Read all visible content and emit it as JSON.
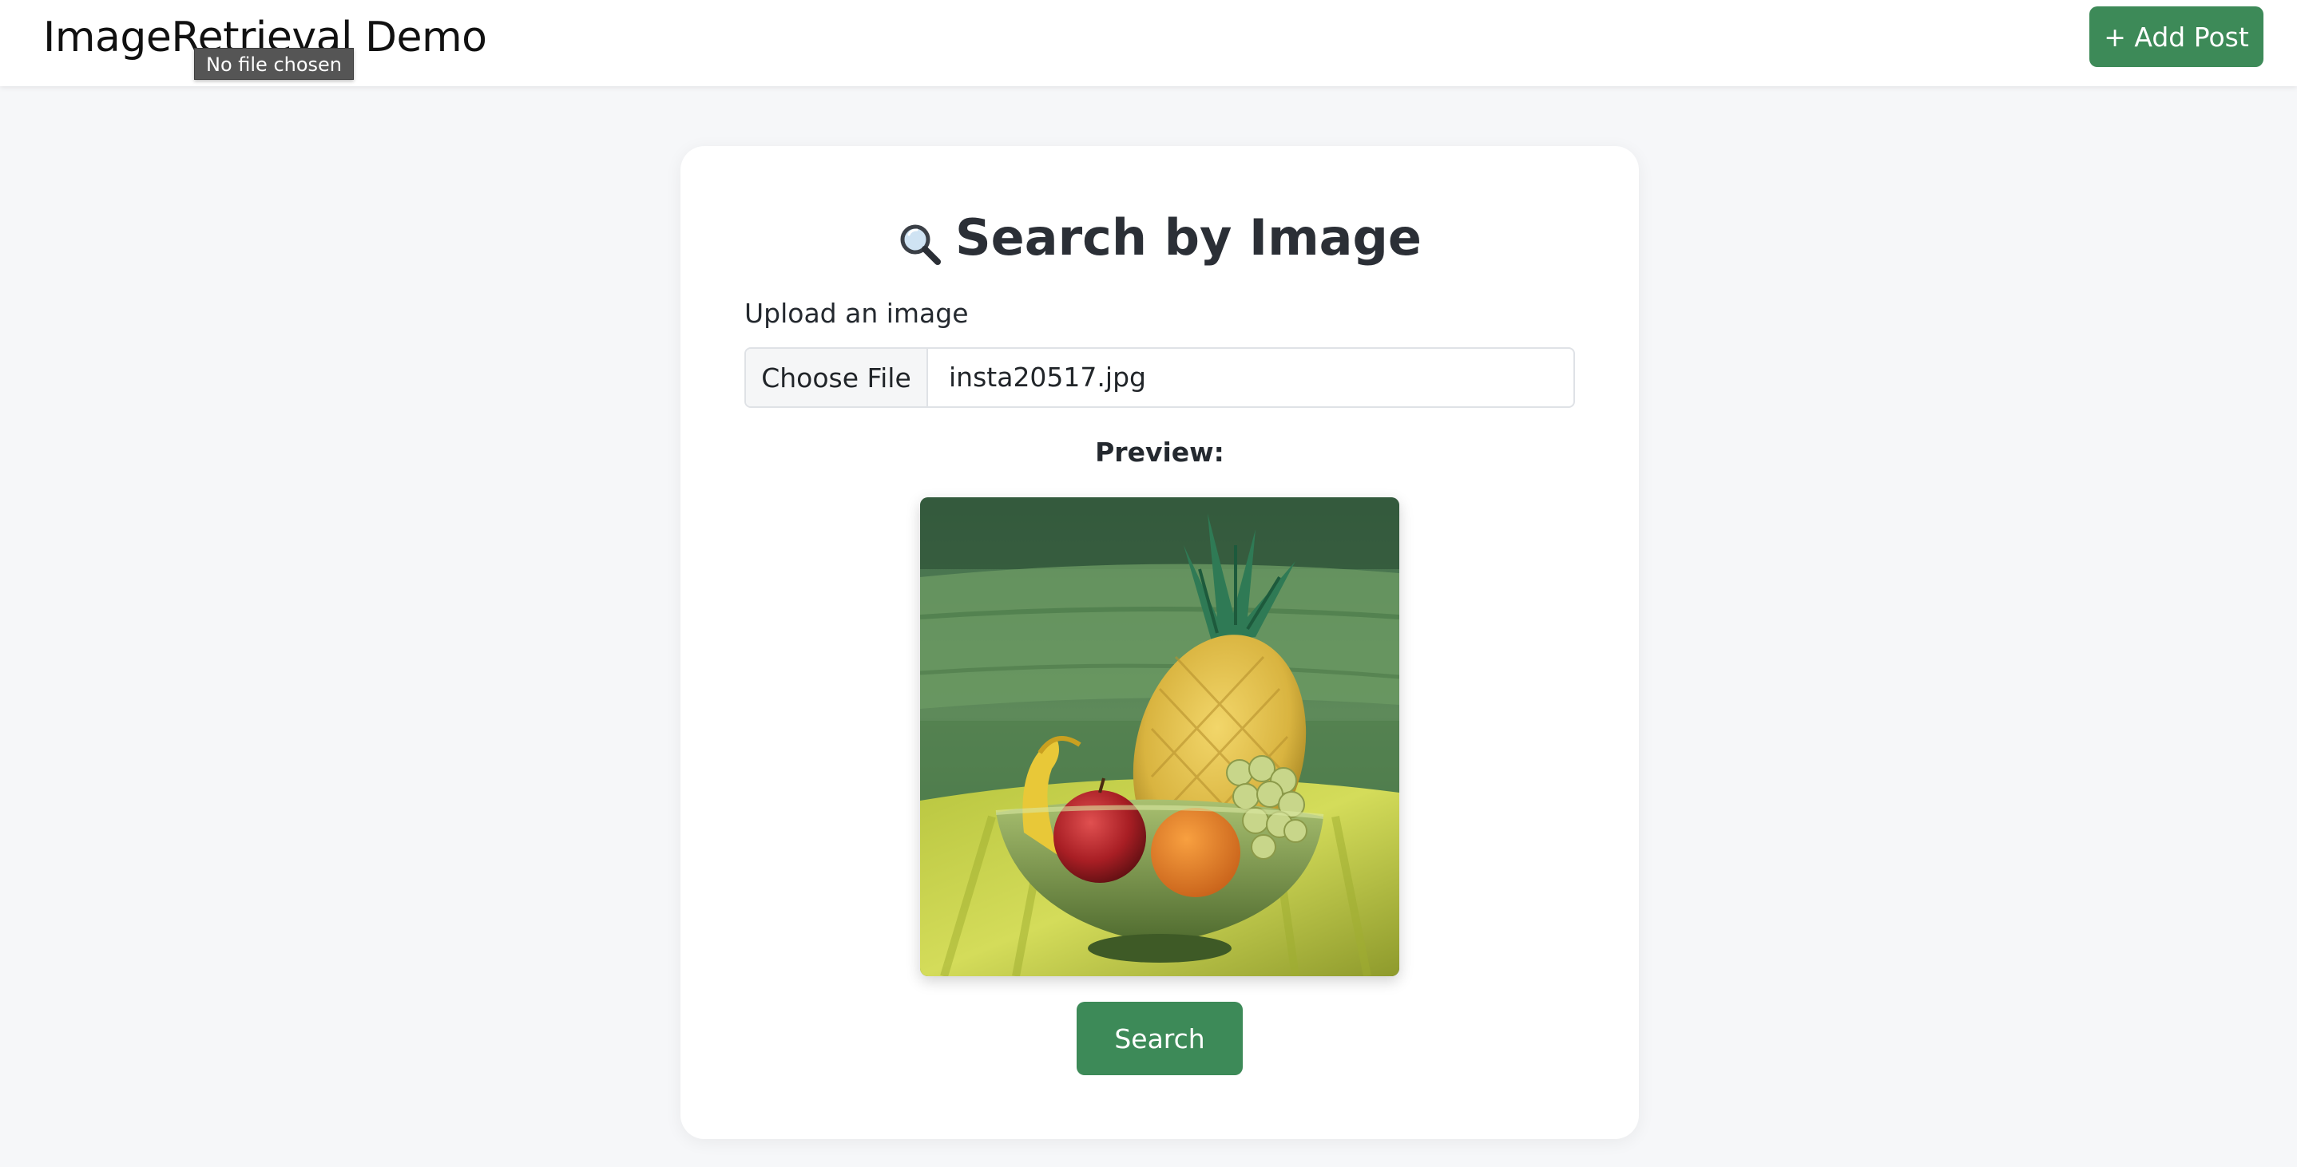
{
  "header": {
    "brand": "ImageRetrieval Demo",
    "tooltip": "No file chosen",
    "add_post_label": "+ Add Post"
  },
  "search": {
    "title": "Search by Image",
    "title_icon": "magnifying-glass-icon",
    "upload_label": "Upload an image",
    "choose_file_label": "Choose File",
    "selected_file": "insta20517.jpg",
    "preview_label": "Preview:",
    "preview_image": "pineapple-bag-in-fruit-bowl-photo",
    "search_button_label": "Search"
  },
  "colors": {
    "accent": "#3d8a58",
    "background": "#f6f7f9",
    "card": "#ffffff"
  }
}
